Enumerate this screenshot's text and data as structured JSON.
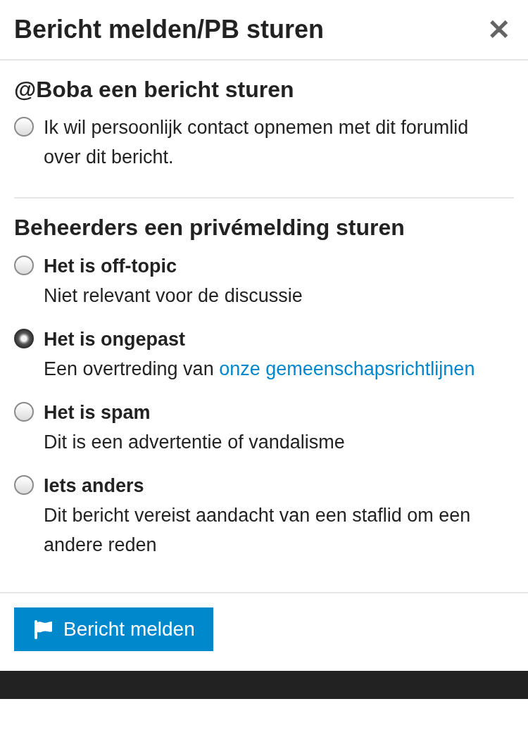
{
  "dialog": {
    "title": "Bericht melden/PB sturen",
    "close_label": "✕"
  },
  "sections": [
    {
      "heading": "@Boba een bericht sturen",
      "options": [
        {
          "label": "Ik wil persoonlijk contact opnemen met dit forumlid over dit bericht.",
          "kind": "plain",
          "selected": false
        }
      ]
    },
    {
      "heading": "Beheerders een privémelding sturen",
      "options": [
        {
          "label": "Het is off-topic",
          "description": "Niet relevant voor de discussie",
          "kind": "titled",
          "selected": false
        },
        {
          "label": "Het is ongepast",
          "description": "Een overtreding van",
          "link": "onze gemeenschapsrichtlijnen",
          "kind": "titled",
          "selected": true
        },
        {
          "label": "Het is spam",
          "description": "Dit is een advertentie of vandalisme",
          "kind": "titled",
          "selected": false
        },
        {
          "label": "Iets anders",
          "description": "Dit bericht vereist aandacht van een staflid om een andere reden",
          "kind": "titled",
          "selected": false
        }
      ]
    }
  ],
  "submit": {
    "label": "Bericht melden"
  }
}
